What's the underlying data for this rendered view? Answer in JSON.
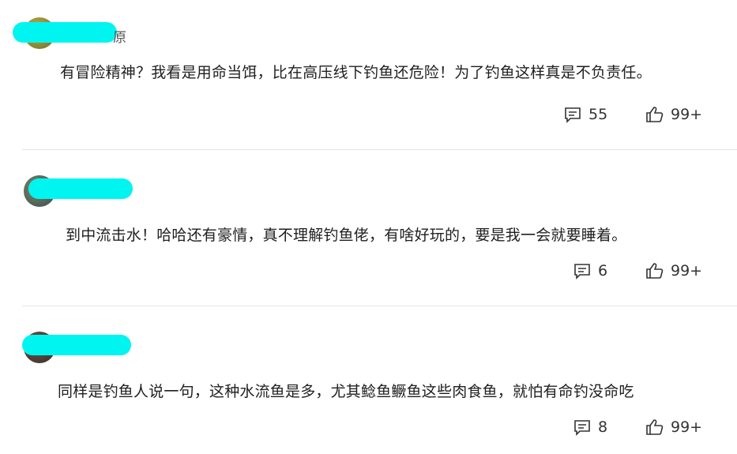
{
  "comments": [
    {
      "name_tail": "原",
      "text": "有冒险精神？我看是用命当饵，比在高压线下钓鱼还危险！为了钓鱼这样真是不负责任。",
      "reply_count": "55",
      "like_count": "99+"
    },
    {
      "name_tail": "",
      "text": "到中流击水！哈哈还有豪情，真不理解钓鱼佬，有啥好玩的，要是我一会就要睡着。",
      "reply_count": "6",
      "like_count": "99+"
    },
    {
      "name_tail": "",
      "text": "同样是钓鱼人说一句，这种水流鱼是多，尤其鲶鱼鳜鱼这些肉食鱼，就怕有命钓没命吃",
      "reply_count": "8",
      "like_count": "99+"
    }
  ],
  "icons": {
    "reply": "comment-icon",
    "like": "thumbs-up-icon"
  },
  "colors": {
    "redaction": "#00f5f0",
    "divider": "#e6e6e6",
    "text": "#1f1f1f"
  }
}
